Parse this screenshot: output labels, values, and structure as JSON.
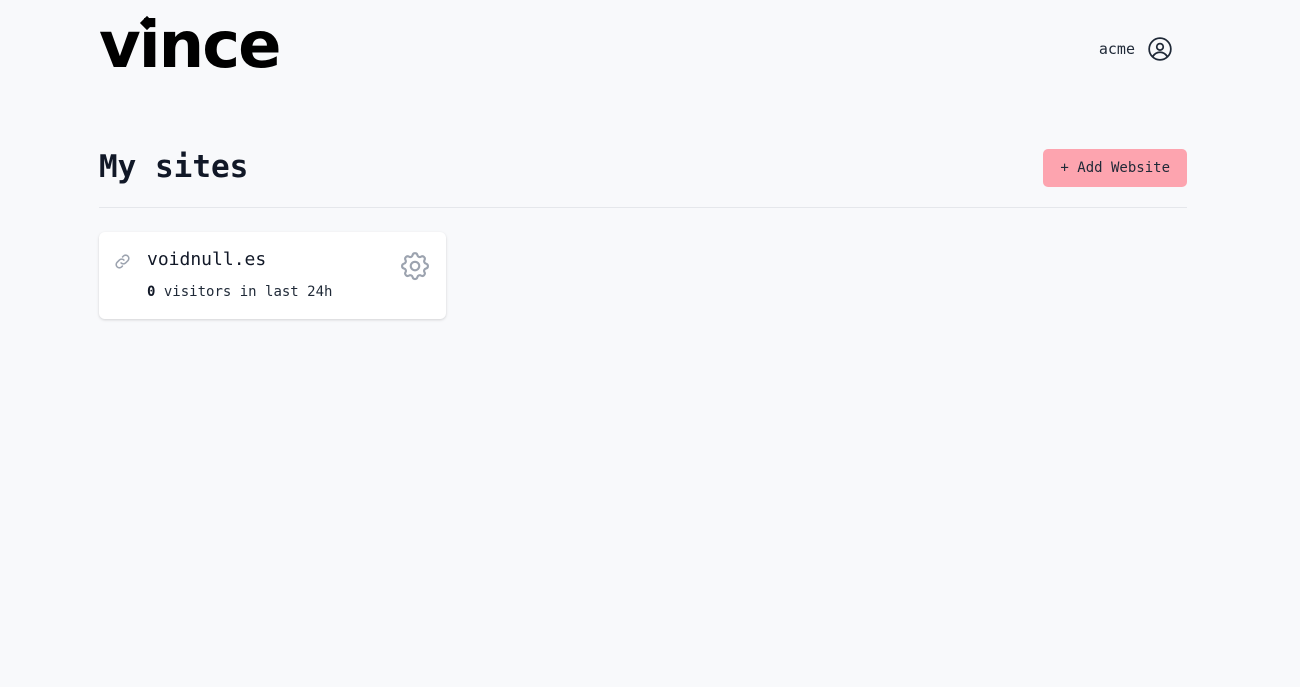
{
  "brand": {
    "logo_text": "vince"
  },
  "user": {
    "name": "acme",
    "avatar_icon": "user-circle-icon"
  },
  "main": {
    "title": "My sites",
    "add_button_label": "+ Add Website"
  },
  "sites": [
    {
      "domain": "voidnull.es",
      "visitors": "0",
      "visitors_suffix": "visitors in last 24h",
      "link_icon": "link-icon",
      "settings_icon": "gear-icon"
    }
  ],
  "colors": {
    "background": "#f8f9fb",
    "accent_button": "#fda4af",
    "card": "#ffffff",
    "icon_gray": "#9ca3af"
  }
}
